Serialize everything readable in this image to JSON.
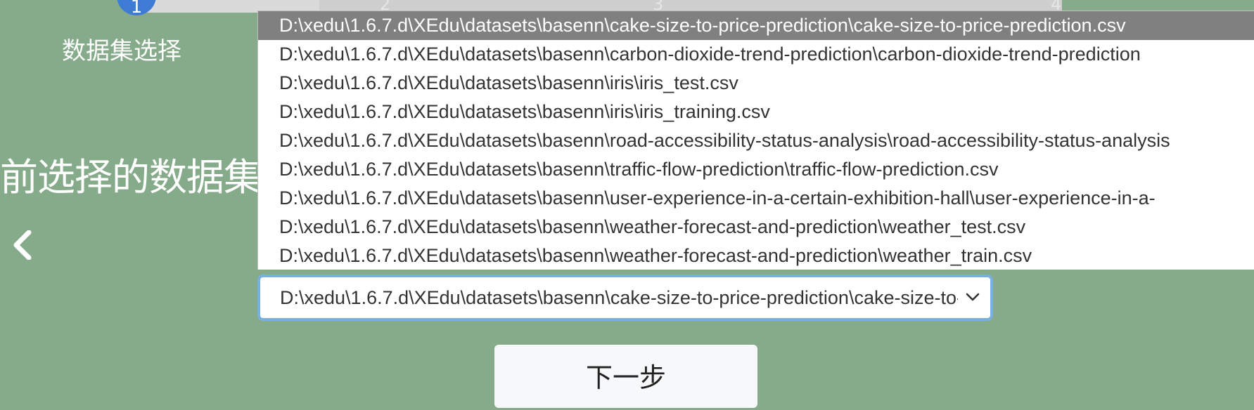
{
  "progress": {
    "fraction": 0.2,
    "steps": [
      {
        "number": "1",
        "label": "数据集选择"
      },
      {
        "number": "2"
      },
      {
        "number": "3"
      },
      {
        "number": "4"
      }
    ]
  },
  "main": {
    "title": "前选择的数据集"
  },
  "dataset_select": {
    "value": "D:\\xedu\\1.6.7.d\\XEdu\\datasets\\basenn\\cake-size-to-price-prediction\\cake-size-to-price-prediction.csv",
    "options": [
      "D:\\xedu\\1.6.7.d\\XEdu\\datasets\\basenn\\cake-size-to-price-prediction\\cake-size-to-price-prediction.csv",
      "D:\\xedu\\1.6.7.d\\XEdu\\datasets\\basenn\\carbon-dioxide-trend-prediction\\carbon-dioxide-trend-prediction",
      "D:\\xedu\\1.6.7.d\\XEdu\\datasets\\basenn\\iris\\iris_test.csv",
      "D:\\xedu\\1.6.7.d\\XEdu\\datasets\\basenn\\iris\\iris_training.csv",
      "D:\\xedu\\1.6.7.d\\XEdu\\datasets\\basenn\\road-accessibility-status-analysis\\road-accessibility-status-analysis",
      "D:\\xedu\\1.6.7.d\\XEdu\\datasets\\basenn\\traffic-flow-prediction\\traffic-flow-prediction.csv",
      "D:\\xedu\\1.6.7.d\\XEdu\\datasets\\basenn\\user-experience-in-a-certain-exhibition-hall\\user-experience-in-a-",
      "D:\\xedu\\1.6.7.d\\XEdu\\datasets\\basenn\\weather-forecast-and-prediction\\weather_test.csv",
      "D:\\xedu\\1.6.7.d\\XEdu\\datasets\\basenn\\weather-forecast-and-prediction\\weather_train.csv"
    ],
    "selected_index": 0
  },
  "footer": {
    "next_label": "下一步"
  },
  "colors": {
    "background": "#85ab8b",
    "step_active": "#3e7bd4",
    "option_selected": "#808080",
    "select_focus_border": "#7ab0df"
  },
  "icons": {
    "prev": "chevron-left-icon",
    "select": "chevron-down-icon"
  }
}
